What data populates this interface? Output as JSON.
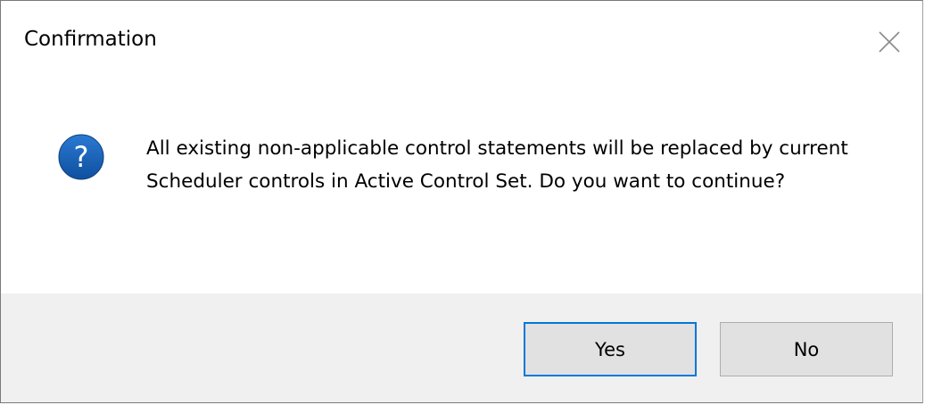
{
  "dialog": {
    "title": "Confirmation",
    "close_icon": "close-icon",
    "icon": "question-icon",
    "icon_glyph": "?",
    "message": "All existing non-applicable control statements will be replaced by current Scheduler controls in Active Control Set.  Do you want to continue?",
    "buttons": {
      "yes": "Yes",
      "no": "No"
    }
  },
  "colors": {
    "accent": "#0078d7",
    "icon_blue": "#1a5fb4",
    "footer_bg": "#f0f0f0",
    "button_bg": "#e1e1e1"
  }
}
